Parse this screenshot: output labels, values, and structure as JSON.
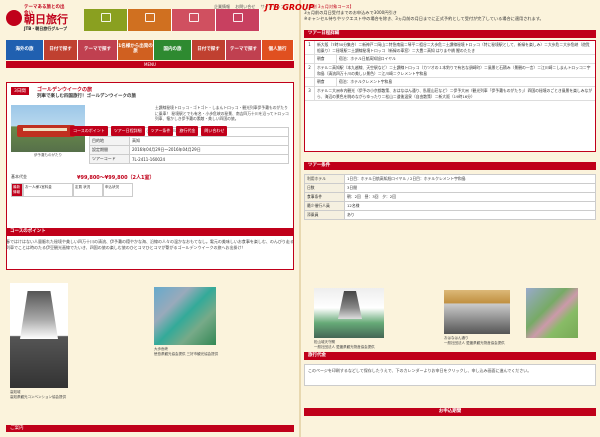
{
  "header": {
    "tagline": "テーマある旅との出会い",
    "brand": "朝日旅行",
    "brand_sub": "JTB・朝日旅行グループ",
    "links": [
      "企業情報",
      "お問い合せ",
      "サイトマップ"
    ],
    "jtb": "JTB GROUP",
    "top_icons": [
      {
        "icon": "tour-icon",
        "color": "#8aa020"
      },
      {
        "icon": "plane-icon",
        "color": "#d07020"
      },
      {
        "icon": "book-icon",
        "color": "#d05060"
      },
      {
        "icon": "calendar-icon",
        "color": "#c84060"
      },
      {
        "icon": "mail-icon",
        "color": "#b0a020"
      }
    ],
    "nav": [
      {
        "label": "海外の旅",
        "color": "#2060b0"
      },
      {
        "label": "日付で探す",
        "color": "#c04030"
      },
      {
        "label": "テーマで探す",
        "color": "#c04050"
      },
      {
        "label": "1名様から出発の旅",
        "color": "#d06020"
      },
      {
        "label": "国内の旅",
        "color": "#2e8a30"
      },
      {
        "label": "日付で探す",
        "color": "#c04030"
      },
      {
        "label": "テーマで探す",
        "color": "#c04050"
      },
      {
        "label": "個人旅行",
        "color": "#e05020"
      }
    ],
    "menu": "MENU"
  },
  "tour": {
    "days": "3日間",
    "title": "ゴールデンウイークの旅",
    "subtitle": "列車で楽しむ四国旅行！ゴールデンウイークの旅",
    "photo_caption": "伊予灘ものがたり",
    "description": "土讃線秘境トロッコ・ゴトゴト・しまんトロッコ・観光列車伊予灘ものがたりに乗車！ 秘境駅とでも有名・小歩危峡の秘景、南吉四万十川を沿ってトロッコ列車、懐かしき伊予灘の素敵・美しい四国の旅。",
    "info": [
      {
        "k": "出発地",
        "v": "近畿圏（新大阪・新神戸）"
      },
      {
        "k": "目的地",
        "v": "高知"
      },
      {
        "k": "設定期間",
        "v": "2016年04月29日～2016年04月29日"
      },
      {
        "k": "ツアーコード",
        "v": "7L-2411-160024"
      }
    ],
    "price_label": "基本代金",
    "price": "¥99,800～¥99,800（2人1室）",
    "cal_label": "最新情報",
    "cal_cells": [
      "お一人様1室料金",
      "定員 状況",
      "申込状況"
    ],
    "tabs": [
      "コースのポイント",
      "ツアー日程詳細",
      "ツアー条件",
      "旅行代金",
      "問い合わせ"
    ]
  },
  "course": {
    "header": "コースのポイント",
    "text": "春ではけはない人量賑れた秘境や美しい四万十川の清流、伊予灘の穏やかな海、沿線の人々の温かなおもてなし。電元の美味しいお食事を楽しむ、のんびり走る列車でことは時のたる伊豆観光画線でたいき、四国の旅の楽しむ旅のひとコマひとコマが繋がるゴールデンウイークの旅へお出掛け！",
    "caption1": "高知城\n高知県観光コンベンション協会提供",
    "caption2": "大歩危峡\n徳島県観光協会提供 三好市観光協会提供",
    "note": "ご案内"
  },
  "right": {
    "notice_title": "【早割 3ヵ月対象コース】",
    "notice_lines": [
      "3ヵ月前の月日受付までのお申込みで3000円引き",
      "※キャンセル待ちやリクエスト中の場合を除き、3ヵ月前の月日までに正式予約として受付が完了している場合に適用されます。"
    ],
    "schedule_header": "ツアー日程詳細",
    "schedule": [
      {
        "n": "1",
        "t": "新大阪（7時30分集合）＝新神戸＝岡山＝特急南風＝琴平＝祖谷＝大歩危＝土讃線秘境トロッコ（特に秘境駅として、新緑を楽しみ）＝大歩危＝大歩危峡（遊覧船乗り）＝秘境駅＝土讃線秘境トロッコ（新緑の車窓）＝大豊＝高知 はりまや橋 鰹のたたき"
      },
      {
        "n": "",
        "t": "宿泊：ホテル日航高知旭ロイヤル",
        "lab": "朝食"
      },
      {
        "n": "2",
        "t": "ホテル＝高知駅（本九越線、天空駅など）＝土讃線トロッコ（カツオの１本釣りで有名な須崎町）＝風景と石積み（景観の一言）＝江川崎＝しまんトロッコ＝宇和島（清流四万十川の美しい景色）＝江川崎＝クレメント宇和島"
      },
      {
        "n": "",
        "t": "宿泊：ホテルクレメント宇和島",
        "lab": "朝食"
      },
      {
        "n": "3",
        "t": "ホテル＝大洲市内観光（伊予の小京都散策、おはなはん通り、臥龍山荘など）＝伊予大洲（観光列車「伊予灘ものがたり」）四国の秘境のごとき風景を楽しみながら、海辺の景色を眺めながらゆったり＝松山＝道後温泉（自由散策）＝新大阪（19時16分）"
      }
    ],
    "cond_header": "ツアー条件",
    "cond": [
      {
        "k": "利用ホテル",
        "v": "1日目：ホテル日航高知旭ロイヤル / 2日目：ホテルクレメント宇和島"
      },
      {
        "k": "日数",
        "v": "3日間"
      },
      {
        "k": "食事条件",
        "v": "朝：2回　昼：3回　夕：2回"
      },
      {
        "k": "最少催行人員",
        "v": "12名様"
      },
      {
        "k": "添乗員",
        "v": "あり"
      }
    ],
    "cap_castle": "松山城天守閣\n一般社団法人 愛媛県観光物産協会提供",
    "cap_street": "おはなはん通り\n一般社団法人 愛媛県観光物産協会提供",
    "fee_header": "旅行代金",
    "cal_note": "このページを印刷するなどして保存したうえで、下のカレンダーよりお申日をクリックし、申し込み画面に進んでください。",
    "footer": "お申込期間"
  }
}
